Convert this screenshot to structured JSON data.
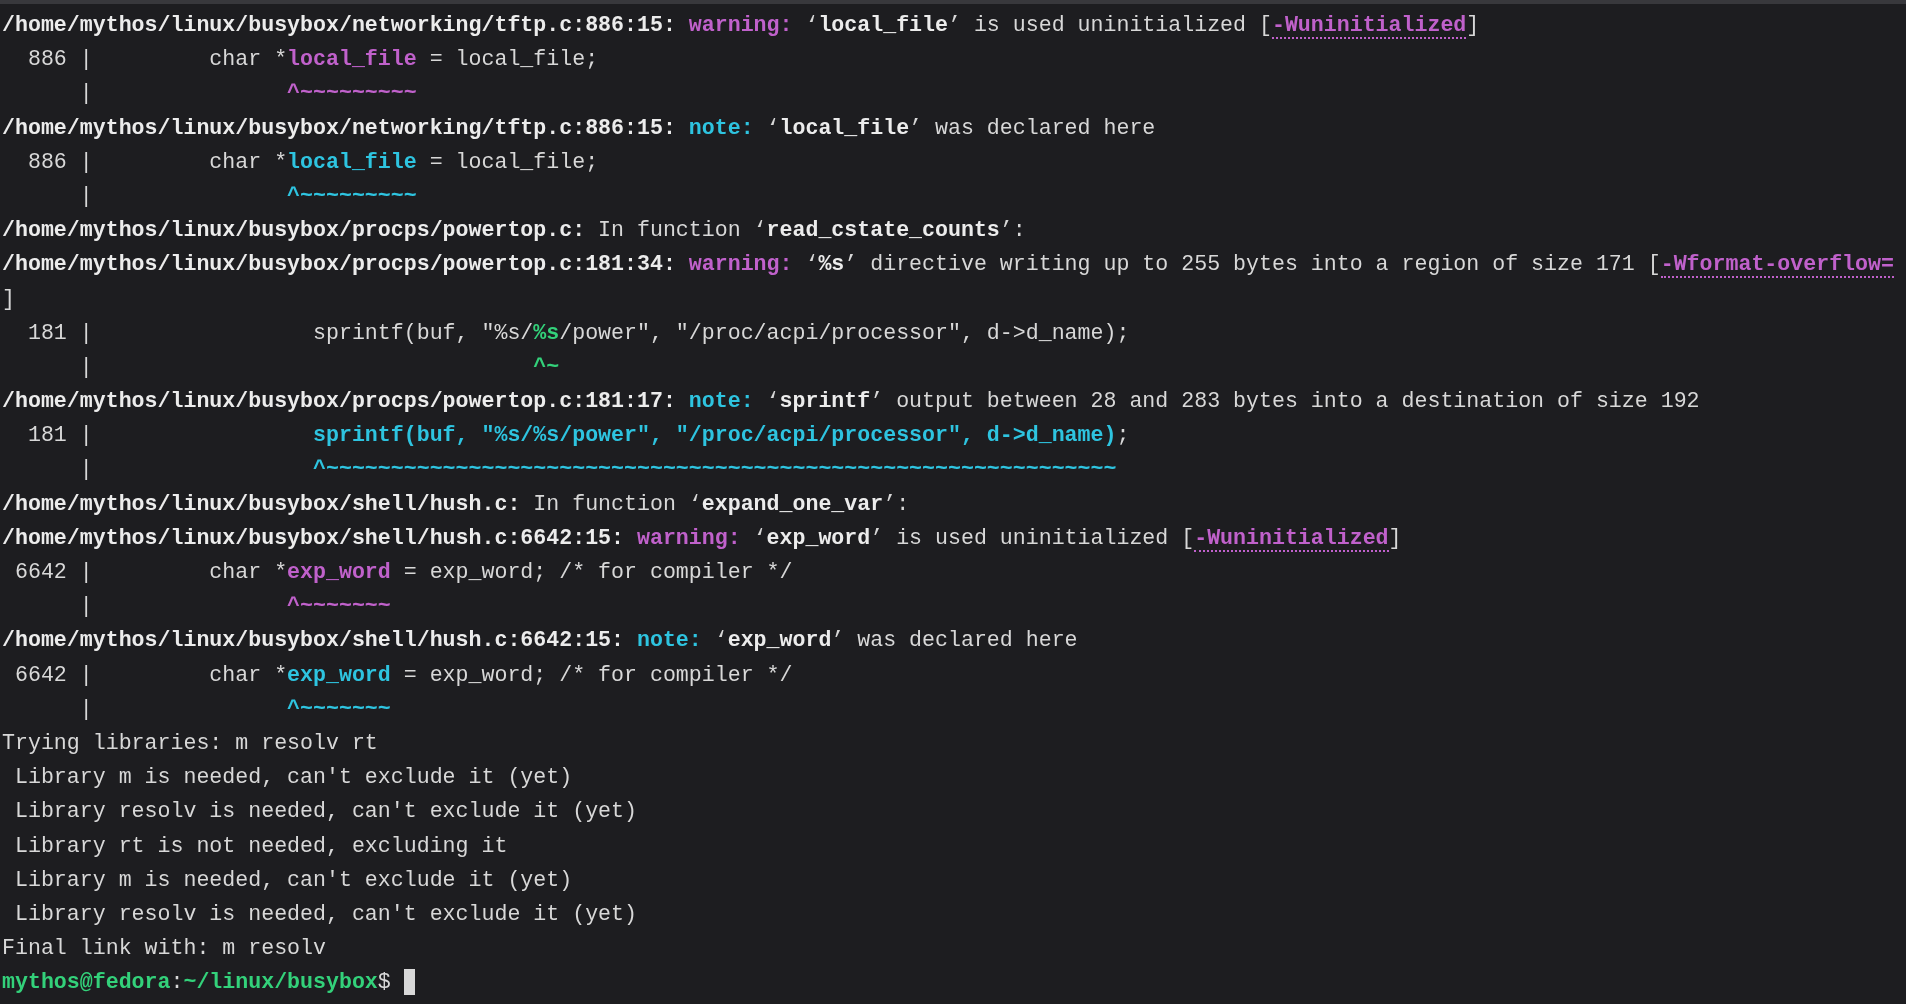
{
  "lines": [
    {
      "segments": [
        {
          "text": "/home/mythos/linux/busybox/networking/tftp.c:886:15: ",
          "kind": "path"
        },
        {
          "text": "warning:",
          "kind": "warning"
        },
        {
          "text": " ‘",
          "kind": "plain"
        },
        {
          "text": "local_file",
          "kind": "bold"
        },
        {
          "text": "’ is used uninitialized [",
          "kind": "plain"
        },
        {
          "text": "-Wuninitialized",
          "kind": "link"
        },
        {
          "text": "]",
          "kind": "plain"
        }
      ]
    },
    {
      "segments": [
        {
          "text": "  886 |         char *",
          "kind": "plain"
        },
        {
          "text": "local_file",
          "kind": "warning"
        },
        {
          "text": " = local_file;",
          "kind": "plain"
        }
      ]
    },
    {
      "segments": [
        {
          "text": "      |               ",
          "kind": "plain"
        },
        {
          "text": "^~~~~~~~~~",
          "kind": "warning"
        }
      ]
    },
    {
      "segments": [
        {
          "text": "/home/mythos/linux/busybox/networking/tftp.c:886:15: ",
          "kind": "path"
        },
        {
          "text": "note:",
          "kind": "note"
        },
        {
          "text": " ‘",
          "kind": "plain"
        },
        {
          "text": "local_file",
          "kind": "bold"
        },
        {
          "text": "’ was declared here",
          "kind": "plain"
        }
      ]
    },
    {
      "segments": [
        {
          "text": "  886 |         char *",
          "kind": "plain"
        },
        {
          "text": "local_file",
          "kind": "note"
        },
        {
          "text": " = local_file;",
          "kind": "plain"
        }
      ]
    },
    {
      "segments": [
        {
          "text": "      |               ",
          "kind": "plain"
        },
        {
          "text": "^~~~~~~~~~",
          "kind": "note"
        }
      ]
    },
    {
      "segments": [
        {
          "text": "/home/mythos/linux/busybox/procps/powertop.c:",
          "kind": "path"
        },
        {
          "text": " In function ‘",
          "kind": "plain"
        },
        {
          "text": "read_cstate_counts",
          "kind": "bold"
        },
        {
          "text": "’:",
          "kind": "plain"
        }
      ]
    },
    {
      "segments": [
        {
          "text": "/home/mythos/linux/busybox/procps/powertop.c:181:34: ",
          "kind": "path"
        },
        {
          "text": "warning:",
          "kind": "warning"
        },
        {
          "text": " ‘",
          "kind": "plain"
        },
        {
          "text": "%s",
          "kind": "bold"
        },
        {
          "text": "’ directive writing up to 255 bytes into a region of size 171 [",
          "kind": "plain"
        },
        {
          "text": "-Wformat-overflow=",
          "kind": "link"
        }
      ]
    },
    {
      "segments": [
        {
          "text": "]",
          "kind": "plain"
        }
      ]
    },
    {
      "segments": [
        {
          "text": "  181 |                 sprintf(buf, \"%s/",
          "kind": "plain"
        },
        {
          "text": "%s",
          "kind": "fixit"
        },
        {
          "text": "/power\", \"/proc/acpi/processor\", d->d_name);",
          "kind": "plain"
        }
      ]
    },
    {
      "segments": [
        {
          "text": "      |                                  ",
          "kind": "plain"
        },
        {
          "text": "^~",
          "kind": "fixit"
        }
      ]
    },
    {
      "segments": [
        {
          "text": "/home/mythos/linux/busybox/procps/powertop.c:181:17: ",
          "kind": "path"
        },
        {
          "text": "note:",
          "kind": "note"
        },
        {
          "text": " ‘",
          "kind": "plain"
        },
        {
          "text": "sprintf",
          "kind": "bold"
        },
        {
          "text": "’ output between 28 and 283 bytes into a destination of size 192",
          "kind": "plain"
        }
      ]
    },
    {
      "segments": [
        {
          "text": "  181 |                 ",
          "kind": "plain"
        },
        {
          "text": "sprintf(buf, \"%s/%s/power\", \"/proc/acpi/processor\", d->d_name)",
          "kind": "note"
        },
        {
          "text": ";",
          "kind": "plain"
        }
      ]
    },
    {
      "segments": [
        {
          "text": "      |                 ",
          "kind": "plain"
        },
        {
          "text": "^~~~~~~~~~~~~~~~~~~~~~~~~~~~~~~~~~~~~~~~~~~~~~~~~~~~~~~~~~~~~~",
          "kind": "note"
        }
      ]
    },
    {
      "segments": [
        {
          "text": "/home/mythos/linux/busybox/shell/hush.c:",
          "kind": "path"
        },
        {
          "text": " In function ‘",
          "kind": "plain"
        },
        {
          "text": "expand_one_var",
          "kind": "bold"
        },
        {
          "text": "’:",
          "kind": "plain"
        }
      ]
    },
    {
      "segments": [
        {
          "text": "/home/mythos/linux/busybox/shell/hush.c:6642:15: ",
          "kind": "path"
        },
        {
          "text": "warning:",
          "kind": "warning"
        },
        {
          "text": " ‘",
          "kind": "plain"
        },
        {
          "text": "exp_word",
          "kind": "bold"
        },
        {
          "text": "’ is used uninitialized [",
          "kind": "plain"
        },
        {
          "text": "-Wuninitialized",
          "kind": "link"
        },
        {
          "text": "]",
          "kind": "plain"
        }
      ]
    },
    {
      "segments": [
        {
          "text": " 6642 |         char *",
          "kind": "plain"
        },
        {
          "text": "exp_word",
          "kind": "warning"
        },
        {
          "text": " = exp_word; /* for compiler */",
          "kind": "plain"
        }
      ]
    },
    {
      "segments": [
        {
          "text": "      |               ",
          "kind": "plain"
        },
        {
          "text": "^~~~~~~~",
          "kind": "warning"
        }
      ]
    },
    {
      "segments": [
        {
          "text": "/home/mythos/linux/busybox/shell/hush.c:6642:15: ",
          "kind": "path"
        },
        {
          "text": "note:",
          "kind": "note"
        },
        {
          "text": " ‘",
          "kind": "plain"
        },
        {
          "text": "exp_word",
          "kind": "bold"
        },
        {
          "text": "’ was declared here",
          "kind": "plain"
        }
      ]
    },
    {
      "segments": [
        {
          "text": " 6642 |         char *",
          "kind": "plain"
        },
        {
          "text": "exp_word",
          "kind": "note"
        },
        {
          "text": " = exp_word; /* for compiler */",
          "kind": "plain"
        }
      ]
    },
    {
      "segments": [
        {
          "text": "      |               ",
          "kind": "plain"
        },
        {
          "text": "^~~~~~~~",
          "kind": "note"
        }
      ]
    },
    {
      "segments": [
        {
          "text": "Trying libraries: m resolv rt",
          "kind": "plain"
        }
      ]
    },
    {
      "segments": [
        {
          "text": " Library m is needed, can't exclude it (yet)",
          "kind": "plain"
        }
      ]
    },
    {
      "segments": [
        {
          "text": " Library resolv is needed, can't exclude it (yet)",
          "kind": "plain"
        }
      ]
    },
    {
      "segments": [
        {
          "text": " Library rt is not needed, excluding it",
          "kind": "plain"
        }
      ]
    },
    {
      "segments": [
        {
          "text": " Library m is needed, can't exclude it (yet)",
          "kind": "plain"
        }
      ]
    },
    {
      "segments": [
        {
          "text": " Library resolv is needed, can't exclude it (yet)",
          "kind": "plain"
        }
      ]
    },
    {
      "segments": [
        {
          "text": "Final link with: m resolv",
          "kind": "plain"
        }
      ]
    }
  ],
  "prompt": {
    "segments": [
      {
        "text": "mythos@fedora",
        "kind": "prompt"
      },
      {
        "text": ":",
        "kind": "plain"
      },
      {
        "text": "~/linux/busybox",
        "kind": "prompt"
      },
      {
        "text": "$ ",
        "kind": "plain"
      }
    ]
  }
}
